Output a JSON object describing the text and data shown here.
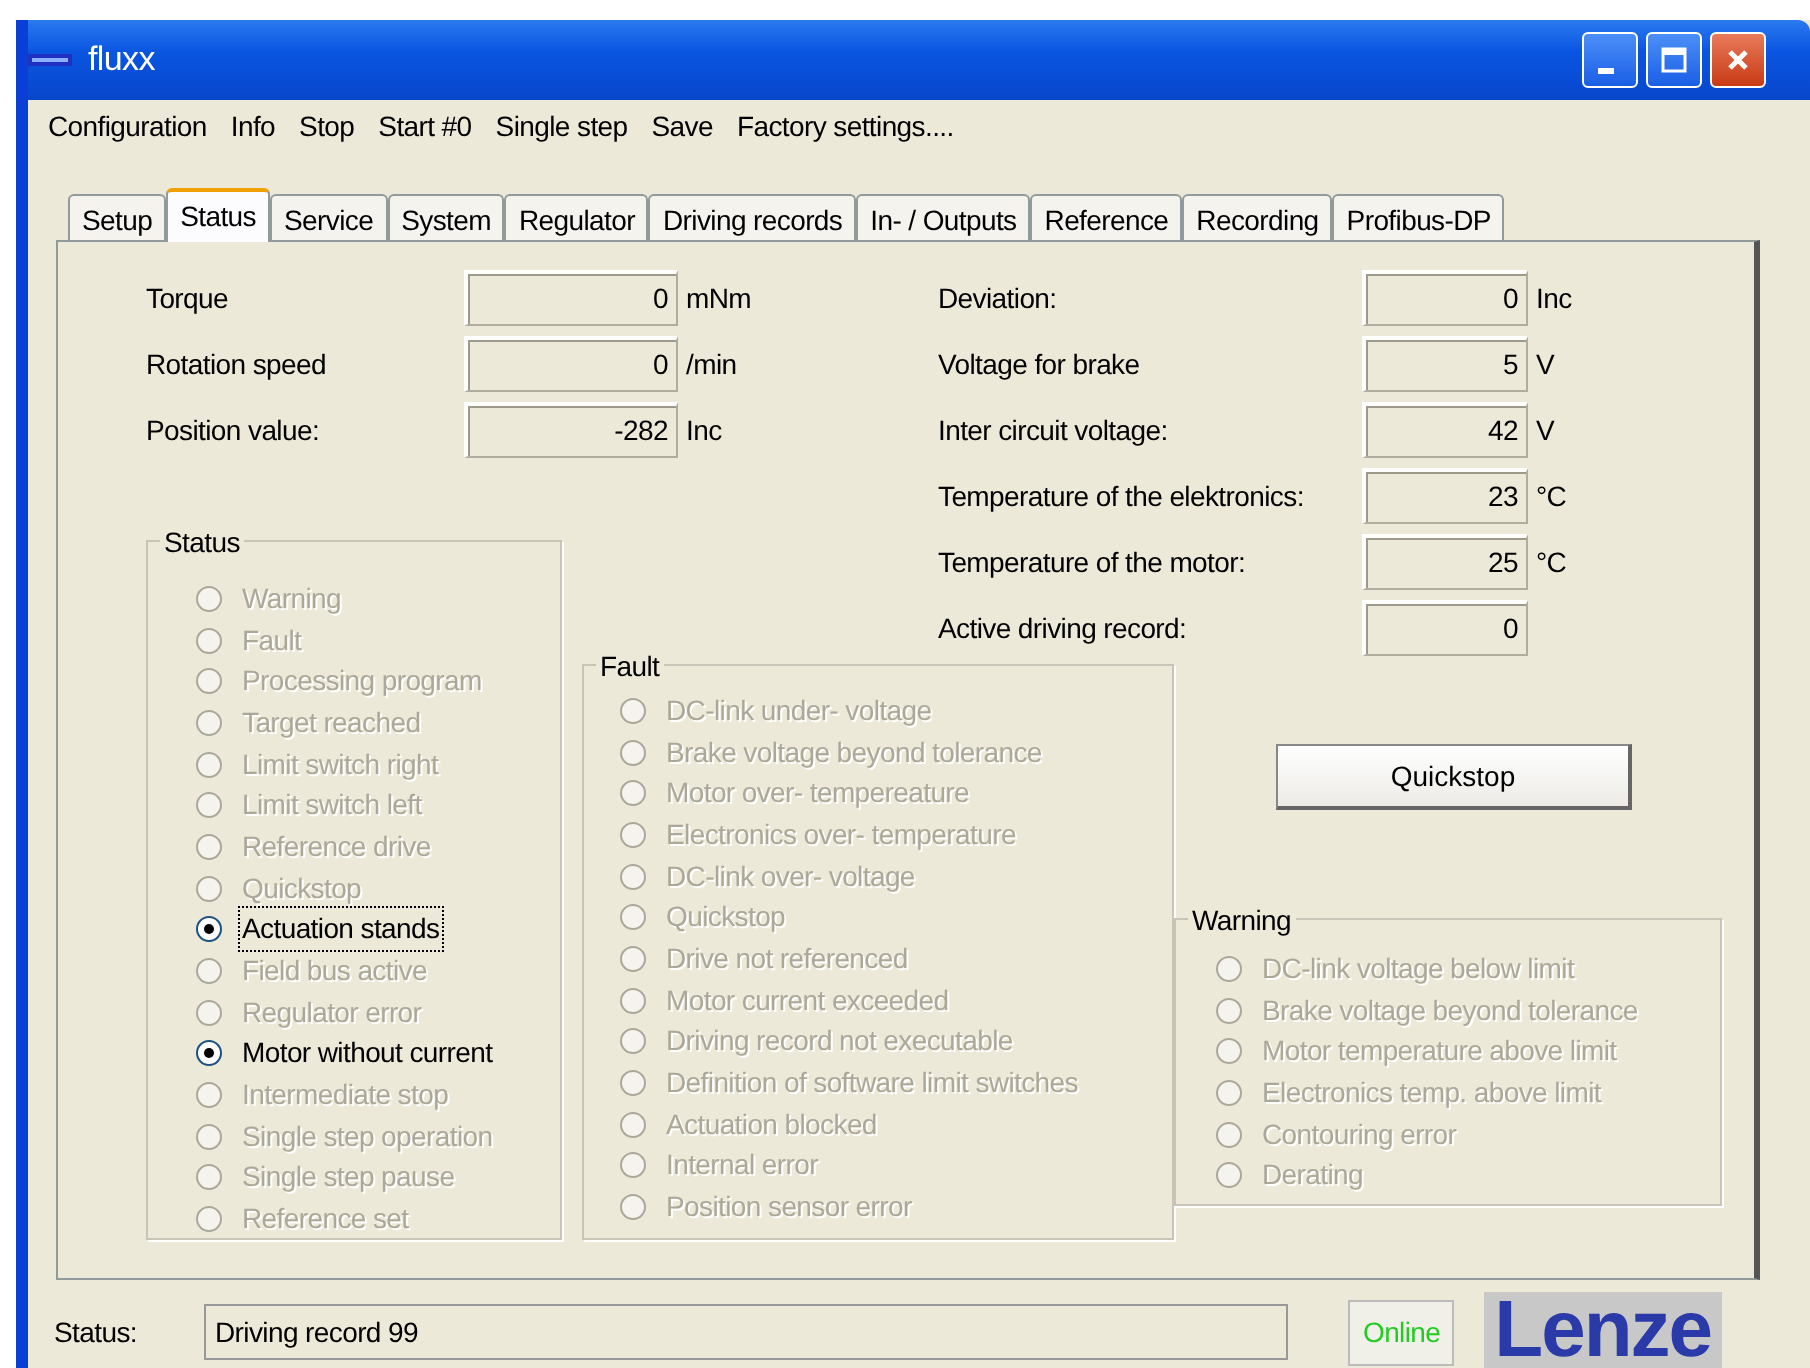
{
  "window": {
    "title": "fluxx"
  },
  "menu": [
    "Configuration",
    "Info",
    "Stop",
    "Start #0",
    "Single step",
    "Save",
    "Factory settings...."
  ],
  "tabs": [
    {
      "label": "Setup",
      "selected": false
    },
    {
      "label": "Status",
      "selected": true
    },
    {
      "label": "Service",
      "selected": false
    },
    {
      "label": "System",
      "selected": false
    },
    {
      "label": "Regulator",
      "selected": false
    },
    {
      "label": "Driving records",
      "selected": false
    },
    {
      "label": "In- / Outputs",
      "selected": false
    },
    {
      "label": "Reference",
      "selected": false
    },
    {
      "label": "Recording",
      "selected": false
    },
    {
      "label": "Profibus-DP",
      "selected": false
    }
  ],
  "readings_left": [
    {
      "label": "Torque",
      "value": "0",
      "unit": "mNm"
    },
    {
      "label": "Rotation speed",
      "value": "0",
      "unit": "/min"
    },
    {
      "label": "Position value:",
      "value": "-282",
      "unit": "Inc"
    }
  ],
  "readings_right": [
    {
      "label": "Deviation:",
      "value": "0",
      "unit": "Inc"
    },
    {
      "label": "Voltage for brake",
      "value": "5",
      "unit": "V"
    },
    {
      "label": "Inter circuit voltage:",
      "value": "42",
      "unit": "V"
    },
    {
      "label": "Temperature of the elektronics:",
      "value": "23",
      "unit": "°C"
    },
    {
      "label": "Temperature of the motor:",
      "value": "25",
      "unit": "°C"
    },
    {
      "label": "Active driving record:",
      "value": "0"
    }
  ],
  "status_group": {
    "title": "Status",
    "options": [
      {
        "label": "Warning",
        "checked": false,
        "focused": false
      },
      {
        "label": "Fault",
        "checked": false,
        "focused": false
      },
      {
        "label": "Processing program",
        "checked": false,
        "focused": false
      },
      {
        "label": "Target reached",
        "checked": false,
        "focused": false
      },
      {
        "label": "Limit switch right",
        "checked": false,
        "focused": false
      },
      {
        "label": "Limit switch left",
        "checked": false,
        "focused": false
      },
      {
        "label": "Reference drive",
        "checked": false,
        "focused": false
      },
      {
        "label": "Quickstop",
        "checked": false,
        "focused": false
      },
      {
        "label": "Actuation stands",
        "checked": true,
        "focused": true
      },
      {
        "label": "Field bus active",
        "checked": false,
        "focused": false
      },
      {
        "label": "Regulator error",
        "checked": false,
        "focused": false
      },
      {
        "label": "Motor without current",
        "checked": true,
        "focused": false
      },
      {
        "label": "Intermediate stop",
        "checked": false,
        "focused": false
      },
      {
        "label": "Single step operation",
        "checked": false,
        "focused": false
      },
      {
        "label": "Single step pause",
        "checked": false,
        "focused": false
      },
      {
        "label": "Reference set",
        "checked": false,
        "focused": false
      }
    ]
  },
  "fault_group": {
    "title": "Fault",
    "options": [
      {
        "label": "DC-link under- voltage",
        "checked": false
      },
      {
        "label": "Brake voltage beyond tolerance",
        "checked": false
      },
      {
        "label": "Motor over- tempereature",
        "checked": false
      },
      {
        "label": "Electronics over- temperature",
        "checked": false
      },
      {
        "label": "DC-link over- voltage",
        "checked": false
      },
      {
        "label": "Quickstop",
        "checked": false
      },
      {
        "label": "Drive not referenced",
        "checked": false
      },
      {
        "label": "Motor current exceeded",
        "checked": false
      },
      {
        "label": "Driving record not executable",
        "checked": false
      },
      {
        "label": "Definition of software limit switches",
        "checked": false
      },
      {
        "label": "Actuation blocked",
        "checked": false
      },
      {
        "label": "Internal error",
        "checked": false
      },
      {
        "label": "Position sensor error",
        "checked": false
      }
    ]
  },
  "quickstop_button": "Quickstop",
  "warning_group": {
    "title": "Warning",
    "options": [
      {
        "label": "DC-link voltage below limit",
        "checked": false
      },
      {
        "label": "Brake voltage beyond tolerance",
        "checked": false
      },
      {
        "label": "Motor temperature above limit",
        "checked": false
      },
      {
        "label": "Electronics temp. above limit",
        "checked": false
      },
      {
        "label": "Contouring error",
        "checked": false
      },
      {
        "label": "Derating",
        "checked": false
      }
    ]
  },
  "status_bar": {
    "label": "Status:",
    "value": "Driving record 99",
    "connection": "Online",
    "logo": "Lenze"
  }
}
